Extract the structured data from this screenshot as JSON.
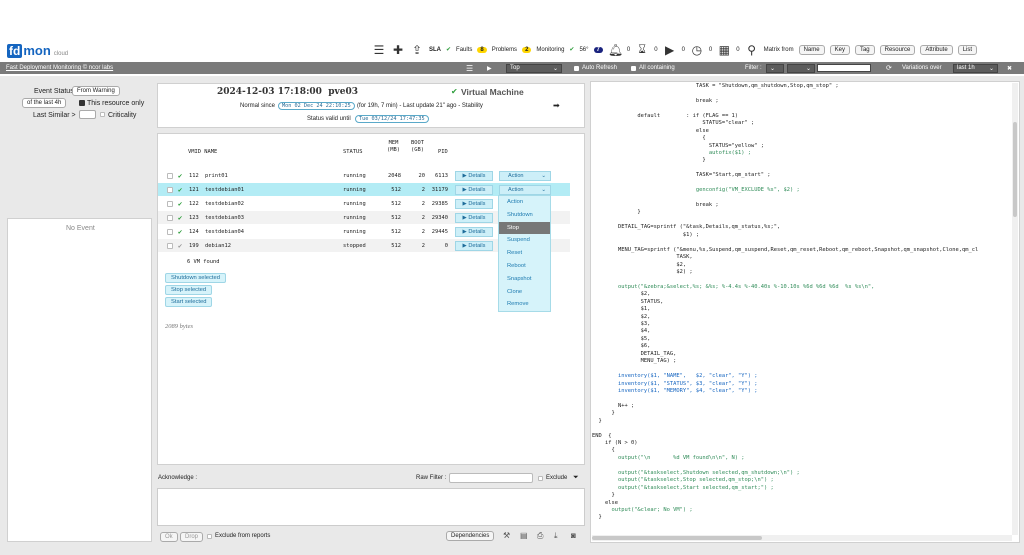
{
  "app": {
    "fd": "fd",
    "mon": "mon",
    "cloud": "cloud"
  },
  "topbar": {
    "sla": "SLA",
    "faults": "Faults",
    "faults_count": "8",
    "problems": "Problems",
    "problems_count": "2",
    "monitoring": "Monitoring",
    "monitoring_temp": "56°",
    "monitoring_count": "7",
    "bell_count": "0",
    "hourglass_count": "0",
    "play_count": "0",
    "clock_count": "0",
    "calendar_count": "0",
    "matrix_from": "Matrix from",
    "matrix_buttons": [
      "Name",
      "Key",
      "Tag",
      "Resource",
      "Attribute",
      "List"
    ]
  },
  "graybar": {
    "title": "Fast Deployment Monitoring © ncor labs",
    "top_value": "Top",
    "auto_refresh": "Auto Refresh",
    "all_containing": "All containing",
    "filter_label": "Filter :",
    "variations_over": "Variations over",
    "variations_value": "last 1h"
  },
  "left": {
    "event_status": "Event Status",
    "from_warning": "From Warning",
    "last_4h": "of the last 4h",
    "resource_only": "This resource only",
    "last_similar": "Last Similar >",
    "criticality": "Criticality",
    "no_event": "No Event"
  },
  "header": {
    "datetime": "2024-12-03 17:18:00",
    "host": "pve03",
    "vm_title": "Virtual Machine",
    "normal_since": "Normal since",
    "since_time": "Mon 02 Dec 24 22:10:25",
    "duration": "(for 19h, 7 min) - Last update 21\" ago - Stability",
    "status_valid": "Status valid until",
    "valid_time": "Tue 03/12/24 17:47:35"
  },
  "table": {
    "headers": {
      "vmid_name": "VMID NAME",
      "status": "STATUS",
      "mem": "MEM\n(MB)",
      "boot": "BOOT\n(GB)",
      "pid": "PID"
    },
    "rows": [
      {
        "vmid": "112",
        "name": "print01",
        "status": "running",
        "mem": "2048",
        "boot": "20",
        "pid": "6113"
      },
      {
        "vmid": "121",
        "name": "testdebian01",
        "status": "running",
        "mem": "512",
        "boot": "2",
        "pid": "31179"
      },
      {
        "vmid": "122",
        "name": "testdebian02",
        "status": "running",
        "mem": "512",
        "boot": "2",
        "pid": "29385"
      },
      {
        "vmid": "123",
        "name": "testdebian03",
        "status": "running",
        "mem": "512",
        "boot": "2",
        "pid": "29340"
      },
      {
        "vmid": "124",
        "name": "testdebian04",
        "status": "running",
        "mem": "512",
        "boot": "2",
        "pid": "29445"
      },
      {
        "vmid": "199",
        "name": "debian12",
        "status": "stopped",
        "mem": "512",
        "boot": "2",
        "pid": "0"
      }
    ],
    "details": "▶ Details",
    "action": "Action",
    "found": "6 VM found",
    "shutdown_selected": "Shutdown selected",
    "stop_selected": "Stop selected",
    "start_selected": "Start selected",
    "bytes": "2089 bytes"
  },
  "menu": {
    "items": [
      "Action",
      "Shutdown",
      "Stop",
      "Suspend",
      "Reset",
      "Reboot",
      "Snapshot",
      "Clone",
      "Remove"
    ]
  },
  "bottom": {
    "acknowledge": "Acknowledge :",
    "raw_filter": "Raw Filter :",
    "exclude": "Exclude",
    "ok": "Ok",
    "drop": "Drop",
    "exclude_reports": "Exclude from reports",
    "dependencies": "Dependencies"
  },
  "code": {
    "lines": [
      "                                TASK = \"Shutdown,qm_shutdown,Stop,qm_stop\" ;",
      "",
      "                                break ;",
      "",
      "              default        : if (FLAG == 1)",
      "                                  STATUS=\"clear\" ;",
      "                                else",
      "                                  {",
      "                                    STATUS=\"yellow\" ;",
      "                                    autofix($1) ;",
      "                                  }",
      "",
      "                                TASK=\"Start,qm_start\" ;",
      "",
      "                                genconfig(\"VM_EXCLUDE %s\", $2) ;",
      "",
      "                                break ;",
      "              }",
      "",
      "        DETAIL_TAG=sprintf (\"&task,Details,qm_status,%s;\",",
      "                            $1) ;",
      "",
      "        MENU_TAG=sprintf (\"&menu,%s,Suspend,qm_suspend,Reset,qm_reset,Reboot,qm_reboot,Snapshot,qm_snapshot,Clone,qm_cl",
      "                          TASK,",
      "                          $2,",
      "                          $2) ;",
      "",
      "        output(\"&zebra;&select,%s; &%s; %-4.4s %-40.40s %-10.10s %6d %6d %6d  %s %s\\n\",",
      "               $2,",
      "               STATUS,",
      "               $1,",
      "               $2,",
      "               $3,",
      "               $4,",
      "               $5,",
      "               $6,",
      "               DETAIL_TAG,",
      "               MENU_TAG) ;",
      "",
      "        inventory($1, \"NAME\",   $2, \"clear\", \"Y\") ;",
      "        inventory($1, \"STATUS\", $3, \"clear\", \"Y\") ;",
      "        inventory($1, \"MEMORY\", $4, \"clear\", \"Y\") ;",
      "",
      "        N++ ;",
      "      }",
      "  }",
      "",
      "END  {",
      "    if (N > 0)",
      "      {",
      "        output(\"\\n       %d VM found\\n\\n\", N) ;",
      "",
      "        output(\"&taskselect,Shutdown selected,qm_shutdown;\\n\") ;",
      "        output(\"&taskselect,Stop selected,qm_stop;\\n\") ;",
      "        output(\"&taskselect,Start selected,qm_start;\") ;",
      "      }",
      "    else",
      "      output(\"&clear; No VM\") ;",
      "  }"
    ]
  }
}
